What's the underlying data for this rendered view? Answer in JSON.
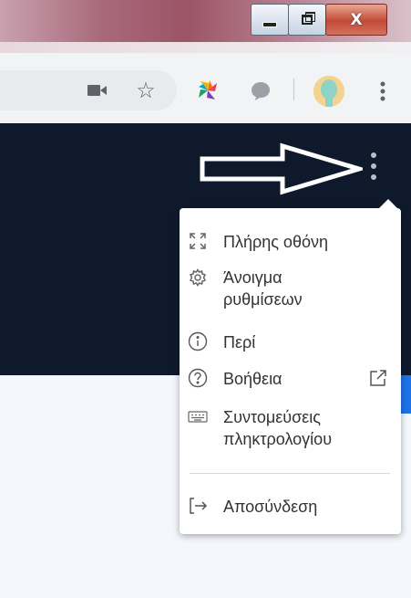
{
  "window": {
    "controls": [
      {
        "name": "minimize",
        "icon": "minimize-icon"
      },
      {
        "name": "restore",
        "icon": "restore-icon"
      },
      {
        "name": "close",
        "glyph": "X",
        "icon": "close-icon"
      }
    ]
  },
  "toolbar": {
    "icons": [
      "camera-icon",
      "star-icon",
      "extension-pinwheel-icon",
      "chat-bubble-icon",
      "avatar",
      "chrome-menu-icon"
    ]
  },
  "menu": {
    "items": [
      {
        "id": "fullscreen",
        "label": "Πλήρης οθόνη",
        "icon": "fullscreen-icon"
      },
      {
        "id": "settings",
        "label": "Άνοιγμα\nρυθμίσεων",
        "icon": "gear-icon"
      },
      {
        "id": "about",
        "label": "Περί",
        "icon": "info-icon"
      },
      {
        "id": "help",
        "label": "Βοήθεια",
        "icon": "help-icon",
        "trailing_icon": "external-link-icon"
      },
      {
        "id": "shortcuts",
        "label": "Συντομεύσεις\nπληκτρολογίου",
        "icon": "keyboard-icon"
      },
      {
        "id": "logout",
        "label": "Αποσύνδεση",
        "icon": "logout-icon"
      }
    ]
  },
  "colors": {
    "page_dark": "#0e1a2c",
    "page_light": "#f4f8fd",
    "accent_blue": "#1e73e8",
    "menu_text": "#333333"
  }
}
